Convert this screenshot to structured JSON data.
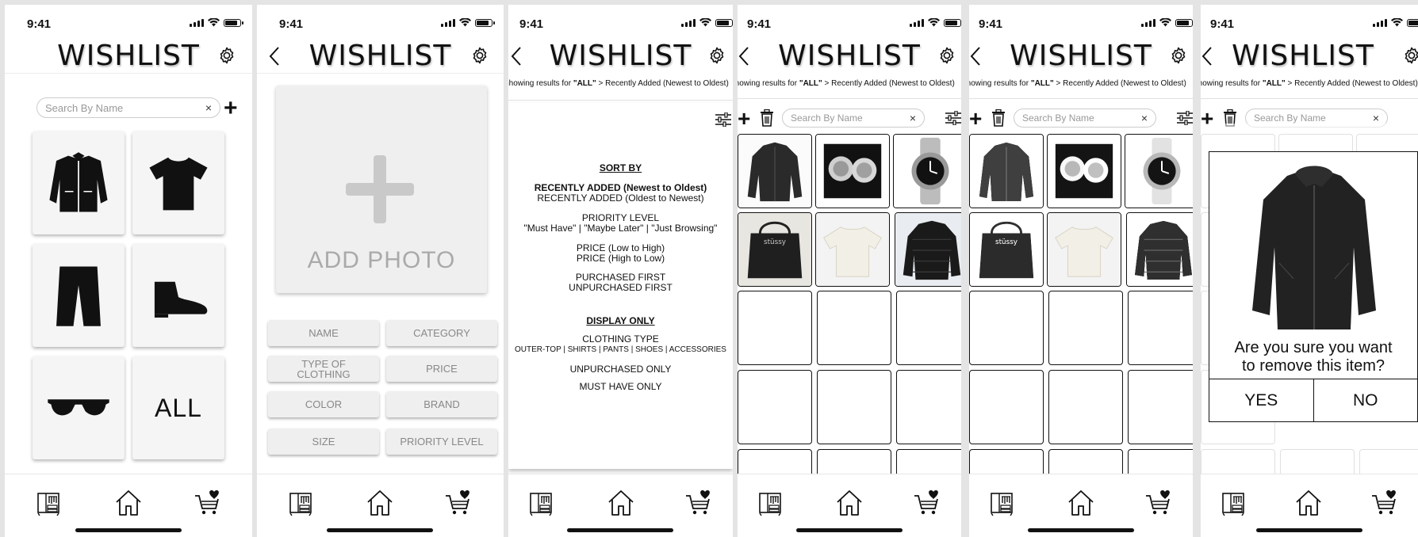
{
  "status": {
    "time": "9:41"
  },
  "app": {
    "title": "WISHLIST"
  },
  "search": {
    "placeholder": "Search By Name",
    "clear": "×"
  },
  "add_symbol": "+",
  "categories": [
    "outer-top",
    "shirts",
    "pants",
    "shoes",
    "accessories",
    "ALL"
  ],
  "add_item": {
    "add_photo_label": "ADD PHOTO",
    "fields": [
      "NAME",
      "CATEGORY",
      "TYPE OF CLOTHING",
      "PRICE",
      "COLOR",
      "BRAND",
      "SIZE",
      "PRIORITY LEVEL"
    ]
  },
  "results": {
    "prefix": "Showing results for ",
    "filter": "\"ALL\"",
    "sep": " > ",
    "sort": "Recently Added (Newest to Oldest)"
  },
  "sort_panel": {
    "sort_by_heading": "SORT BY",
    "recent_newest": "RECENTLY ADDED (Newest to Oldest)",
    "recent_oldest": "RECENTLY ADDED (Oldest to Newest)",
    "priority_level": "PRIORITY LEVEL",
    "priority_options": "\"Must Have\" | \"Maybe Later\" | \"Just Browsing\"",
    "price_low_high": "PRICE (Low to High)",
    "price_high_low": "PRICE (High to Low)",
    "purchased_first": "PURCHASED FIRST",
    "unpurchased_first": "UNPURCHASED FIRST",
    "display_only_heading": "DISPLAY ONLY",
    "clothing_type": "CLOTHING TYPE",
    "clothing_type_options": "OUTER-TOP | SHIRTS | PANTS | SHOES | ACCESSORIES",
    "unpurchased_only": "UNPURCHASED ONLY",
    "must_have_only": "MUST HAVE ONLY"
  },
  "items": [
    "jacket",
    "earrings",
    "watch",
    "tote-bag",
    "t-shirt",
    "puffer-jacket"
  ],
  "confirm_dialog": {
    "question_line1": "Are you sure you want",
    "question_line2": "to remove this item?",
    "yes": "YES",
    "no": "NO"
  },
  "tabs": [
    "closet-icon",
    "home-icon",
    "cart-heart-icon"
  ]
}
